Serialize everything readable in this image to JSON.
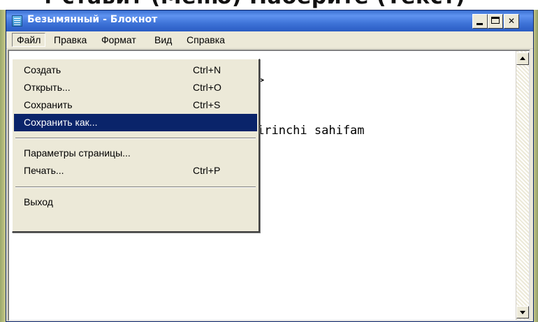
{
  "slide": {
    "heading_fragment": "т ставит (Меню) Наберите (Текст)"
  },
  "window": {
    "title": "Безымянный - Блокнот",
    "icon": "notepad-icon",
    "controls": {
      "minimize": "minimize-icon",
      "maximize": "maximize-icon",
      "close": "✕"
    }
  },
  "menubar": {
    "items": [
      {
        "label": "Файл",
        "open": true
      },
      {
        "label": "Правка"
      },
      {
        "label": "Формат"
      },
      {
        "label": "Вид"
      },
      {
        "label": "Справка"
      }
    ]
  },
  "file_menu": {
    "items": [
      {
        "label": "Создать",
        "shortcut": "Ctrl+N"
      },
      {
        "label": "Открыть...",
        "shortcut": "Ctrl+O"
      },
      {
        "label": "Сохранить",
        "shortcut": "Ctrl+S"
      },
      {
        "label": "Сохранить как...",
        "shortcut": "",
        "selected": true
      },
      {
        "label": "Параметры страницы...",
        "shortcut": ""
      },
      {
        "label": "Печать...",
        "shortcut": "Ctrl+P"
      },
      {
        "label": "Выход",
        "shortcut": ""
      }
    ]
  },
  "editor": {
    "line1_visible": ">",
    "line2_visible": "irinchi sahifam"
  },
  "colors": {
    "titlebar": "#2a5cc4",
    "menu_background": "#ece9d8",
    "selection": "#0a246a"
  }
}
